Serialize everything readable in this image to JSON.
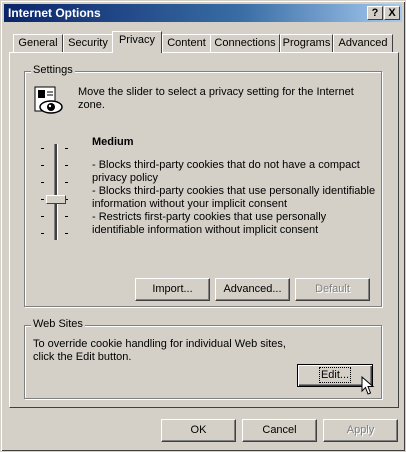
{
  "window": {
    "title": "Internet Options",
    "help_button": "?",
    "close_button": "X"
  },
  "tabs": [
    "General",
    "Security",
    "Privacy",
    "Content",
    "Connections",
    "Programs",
    "Advanced"
  ],
  "active_tab": "Privacy",
  "settings": {
    "label": "Settings",
    "description": "Move the slider to select a privacy setting for the Internet zone.",
    "level_title": "Medium",
    "bullets": [
      "- Blocks third-party cookies that do not have a compact privacy policy",
      "- Blocks third-party cookies that use personally identifiable information without your implicit consent",
      "- Restricts first-party cookies that use personally identifiable information without implicit consent"
    ],
    "slider_level": "Medium",
    "buttons": {
      "import": "Import...",
      "advanced": "Advanced...",
      "default": "Default"
    }
  },
  "web_sites": {
    "label": "Web Sites",
    "description": "To override cookie handling for individual Web sites, click the Edit button.",
    "edit_button": "Edit..."
  },
  "footer": {
    "ok": "OK",
    "cancel": "Cancel",
    "apply": "Apply"
  },
  "colors": {
    "face": "#d4d0c8",
    "title_start": "#0a246a",
    "title_end": "#a6caf0"
  }
}
